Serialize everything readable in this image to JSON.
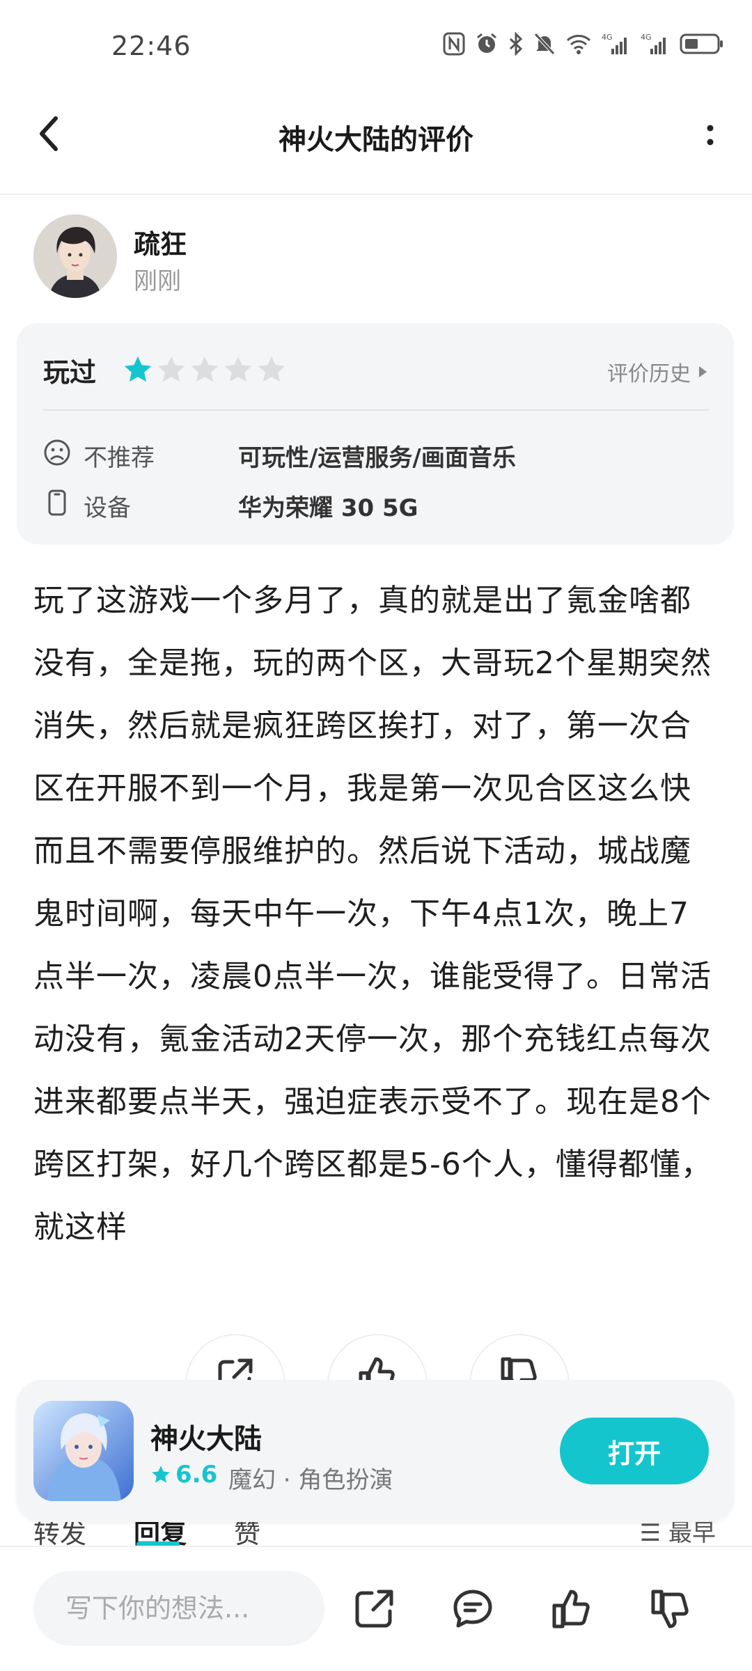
{
  "status_bar": {
    "time": "22:46",
    "icons": [
      "nfc-icon",
      "alarm-icon",
      "bluetooth-icon",
      "mute-icon",
      "wifi-icon",
      "signal-4g-1-icon",
      "signal-4g-2-icon",
      "battery-icon"
    ]
  },
  "header": {
    "title": "神火大陆的评价"
  },
  "user": {
    "name": "疏狂",
    "time": "刚刚"
  },
  "rating": {
    "played_label": "玩过",
    "stars_filled": 1,
    "stars_total": 5,
    "history_label": "评价历史",
    "rows": [
      {
        "icon": "frown-face-icon",
        "label": "不推荐",
        "value": "可玩性/运营服务/画面音乐"
      },
      {
        "icon": "phone-device-icon",
        "label": "设备",
        "value": "华为荣耀 30 5G"
      }
    ]
  },
  "review": {
    "text": "玩了这游戏一个多月了，真的就是出了氪金啥都没有，全是拖，玩的两个区，大哥玩2个星期突然消失，然后就是疯狂跨区挨打，对了，第一次合区在开服不到一个月，我是第一次见合区这么快而且不需要停服维护的。然后说下活动，城战魔鬼时间啊，每天中午一次，下午4点1次，晚上7点半一次，凌晨0点半一次，谁能受得了。日常活动没有，氪金活动2天停一次，那个充钱红点每次进来都要点半天，强迫症表示受不了。现在是8个跨区打架，好几个跨区都是5-6个人，懂得都懂，就这样"
  },
  "tabs": {
    "items": [
      "转发",
      "回复",
      "赞"
    ],
    "active": "回复",
    "sort_label": "最早"
  },
  "app": {
    "name": "神火大陆",
    "score": "6.6",
    "tags": "魔幻 · 角色扮演",
    "open_label": "打开"
  },
  "bottom_bar": {
    "input_placeholder": "写下你的想法...",
    "icons": [
      "share-icon",
      "comment-icon",
      "like-icon",
      "dislike-icon"
    ]
  },
  "colors": {
    "accent": "#15c5ce",
    "star_empty": "#dddddd",
    "card_bg": "#f4f5f7"
  }
}
